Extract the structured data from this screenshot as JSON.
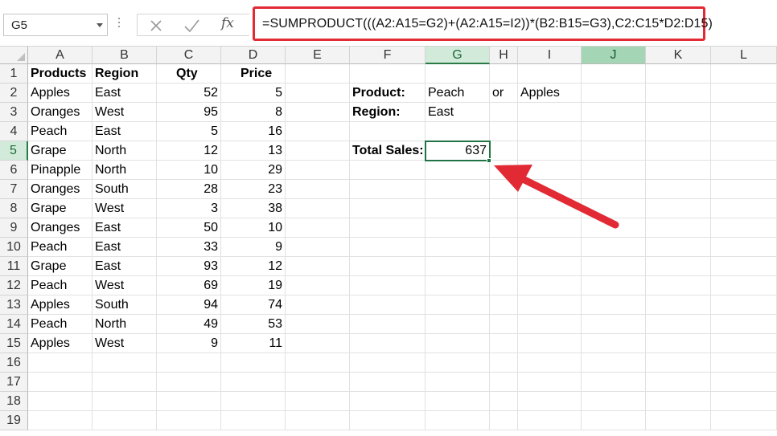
{
  "namebox": {
    "value": "G5"
  },
  "formula_bar": {
    "cancel_icon": "close-icon",
    "enter_icon": "check-icon",
    "function_label": "fx",
    "formula": "=SUMPRODUCT(((A2:A15=G2)+(A2:A15=I2))*(B2:B15=G3),C2:C15*D2:D15)"
  },
  "columns": [
    "A",
    "B",
    "C",
    "D",
    "E",
    "F",
    "G",
    "H",
    "I",
    "J",
    "K",
    "L"
  ],
  "rows": [
    "1",
    "2",
    "3",
    "4",
    "5",
    "6",
    "7",
    "8",
    "9",
    "10",
    "11",
    "12",
    "13",
    "14",
    "15",
    "16",
    "17",
    "18",
    "19"
  ],
  "table": {
    "headers": [
      "Products",
      "Region",
      "Qty",
      "Price"
    ],
    "rows": [
      [
        "Apples",
        "East",
        "52",
        "5"
      ],
      [
        "Oranges",
        "West",
        "95",
        "8"
      ],
      [
        "Peach",
        "East",
        "5",
        "16"
      ],
      [
        "Grape",
        "North",
        "12",
        "13"
      ],
      [
        "Pinapple",
        "North",
        "10",
        "29"
      ],
      [
        "Oranges",
        "South",
        "28",
        "23"
      ],
      [
        "Grape",
        "West",
        "3",
        "38"
      ],
      [
        "Oranges",
        "East",
        "50",
        "10"
      ],
      [
        "Peach",
        "East",
        "33",
        "9"
      ],
      [
        "Grape",
        "East",
        "93",
        "12"
      ],
      [
        "Peach",
        "West",
        "69",
        "19"
      ],
      [
        "Apples",
        "South",
        "94",
        "74"
      ],
      [
        "Peach",
        "North",
        "49",
        "53"
      ],
      [
        "Apples",
        "West",
        "9",
        "11"
      ]
    ]
  },
  "criteria": {
    "product_label": "Product:",
    "product_value": "Peach",
    "or_label": "or",
    "product_value_2": "Apples",
    "region_label": "Region:",
    "region_value": "East",
    "total_label": "Total Sales:",
    "total_value": "637"
  },
  "colors": {
    "selection": "#217346",
    "highlight": "#e12a34"
  }
}
